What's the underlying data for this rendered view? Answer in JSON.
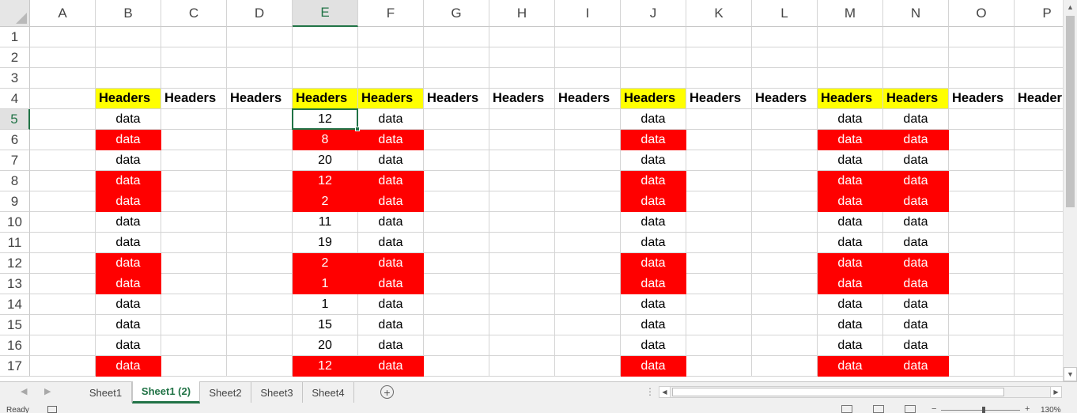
{
  "columns": [
    "A",
    "B",
    "C",
    "D",
    "E",
    "F",
    "G",
    "H",
    "I",
    "J",
    "K",
    "L",
    "M",
    "N",
    "O",
    "P"
  ],
  "rows": [
    "1",
    "2",
    "3",
    "4",
    "5",
    "6",
    "7",
    "8",
    "9",
    "10",
    "11",
    "12",
    "13",
    "14",
    "15",
    "16",
    "17"
  ],
  "selected_cell": {
    "col": "E",
    "row": "5"
  },
  "header_row": {
    "row": "4",
    "text": "Headers",
    "overflow_text": "Header",
    "cells": [
      {
        "col": "B",
        "fill": "yellow"
      },
      {
        "col": "C",
        "fill": "none"
      },
      {
        "col": "D",
        "fill": "none"
      },
      {
        "col": "E",
        "fill": "yellow"
      },
      {
        "col": "F",
        "fill": "yellow"
      },
      {
        "col": "G",
        "fill": "none"
      },
      {
        "col": "H",
        "fill": "none"
      },
      {
        "col": "I",
        "fill": "none"
      },
      {
        "col": "J",
        "fill": "yellow"
      },
      {
        "col": "K",
        "fill": "none"
      },
      {
        "col": "L",
        "fill": "none"
      },
      {
        "col": "M",
        "fill": "yellow"
      },
      {
        "col": "N",
        "fill": "yellow"
      },
      {
        "col": "O",
        "fill": "none"
      },
      {
        "col": "P",
        "fill": "none"
      }
    ]
  },
  "data_label": "data",
  "data_columns": [
    "B",
    "E",
    "F",
    "J",
    "M",
    "N"
  ],
  "data_rows": [
    {
      "row": "5",
      "value": "12",
      "red": false
    },
    {
      "row": "6",
      "value": "8",
      "red": true
    },
    {
      "row": "7",
      "value": "20",
      "red": false
    },
    {
      "row": "8",
      "value": "12",
      "red": true
    },
    {
      "row": "9",
      "value": "2",
      "red": true
    },
    {
      "row": "10",
      "value": "11",
      "red": false
    },
    {
      "row": "11",
      "value": "19",
      "red": false
    },
    {
      "row": "12",
      "value": "2",
      "red": true
    },
    {
      "row": "13",
      "value": "1",
      "red": true
    },
    {
      "row": "14",
      "value": "1",
      "red": false
    },
    {
      "row": "15",
      "value": "15",
      "red": false
    },
    {
      "row": "16",
      "value": "20",
      "red": false
    },
    {
      "row": "17",
      "value": "12",
      "red": true
    }
  ],
  "colors": {
    "highlight_yellow": "#ffff00",
    "flag_red": "#ff0000",
    "excel_green": "#217346"
  },
  "sheet_tabs": [
    {
      "label": "Sheet1",
      "active": false
    },
    {
      "label": "Sheet1 (2)",
      "active": true
    },
    {
      "label": "Sheet2",
      "active": false
    },
    {
      "label": "Sheet3",
      "active": false
    },
    {
      "label": "Sheet4",
      "active": false
    }
  ],
  "add_sheet_symbol": "+",
  "status": {
    "ready": "Ready",
    "zoom": "130%"
  }
}
